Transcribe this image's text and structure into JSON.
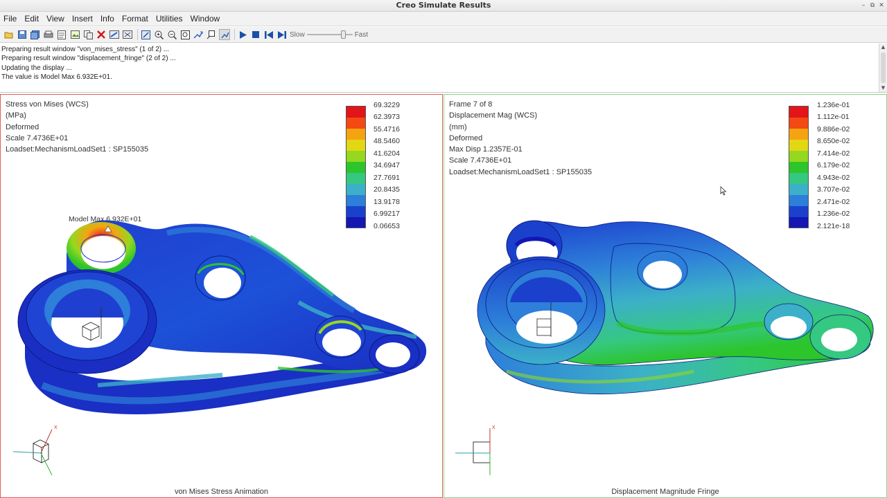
{
  "window": {
    "title": "Creo Simulate Results"
  },
  "menubar": {
    "items": [
      "File",
      "Edit",
      "View",
      "Insert",
      "Info",
      "Format",
      "Utilities",
      "Window"
    ]
  },
  "toolbar": {
    "slow_label": "Slow",
    "fast_label": "Fast",
    "speed_level": 0.75
  },
  "messages": [
    "Preparing result window \"von_mises_stress\" (1 of 2) ...",
    "Preparing result window \"displacement_fringe\" (2 of 2) ...",
    "Updating the display ...",
    "The value is Model Max   6.932E+01."
  ],
  "left_panel": {
    "info_lines": [
      "Stress von Mises (WCS)",
      "(MPa)",
      "Deformed",
      "Scale  7.4736E+01",
      "Loadset:MechanismLoadSet1 :   SP155035"
    ],
    "legend_values": [
      "69.3229",
      "62.3973",
      "55.4716",
      "48.5460",
      "41.6204",
      "34.6947",
      "27.7691",
      "20.8435",
      "13.9178",
      "6.99217",
      "0.06653"
    ],
    "model_max_label": "Model Max  6.932E+01",
    "footer": "von Mises Stress Animation",
    "triad": {
      "x_label": "X"
    }
  },
  "right_panel": {
    "info_lines": [
      "Frame 7 of 8",
      "Displacement Mag (WCS)",
      "(mm)",
      "Deformed",
      "Max Disp  1.2357E-01",
      "Scale  7.4736E+01",
      "Loadset:MechanismLoadSet1 :   SP155035"
    ],
    "legend_values": [
      "1.236e-01",
      "1.112e-01",
      "9.886e-02",
      "8.650e-02",
      "7.414e-02",
      "6.179e-02",
      "4.943e-02",
      "3.707e-02",
      "2.471e-02",
      "1.236e-02",
      "2.121e-18"
    ],
    "footer": "Displacement Magnitude Fringe",
    "triad": {
      "x_label": "X"
    }
  },
  "colors": {
    "fringe_scale": [
      "#e3141a",
      "#f24a12",
      "#f5a311",
      "#e3d714",
      "#95d81f",
      "#2cc52b",
      "#35c880",
      "#3cb0c8",
      "#2d7fd9",
      "#1b41cc",
      "#1417b3"
    ],
    "left_panel_border": "#e35b5b",
    "right_panel_border": "#88d388"
  }
}
